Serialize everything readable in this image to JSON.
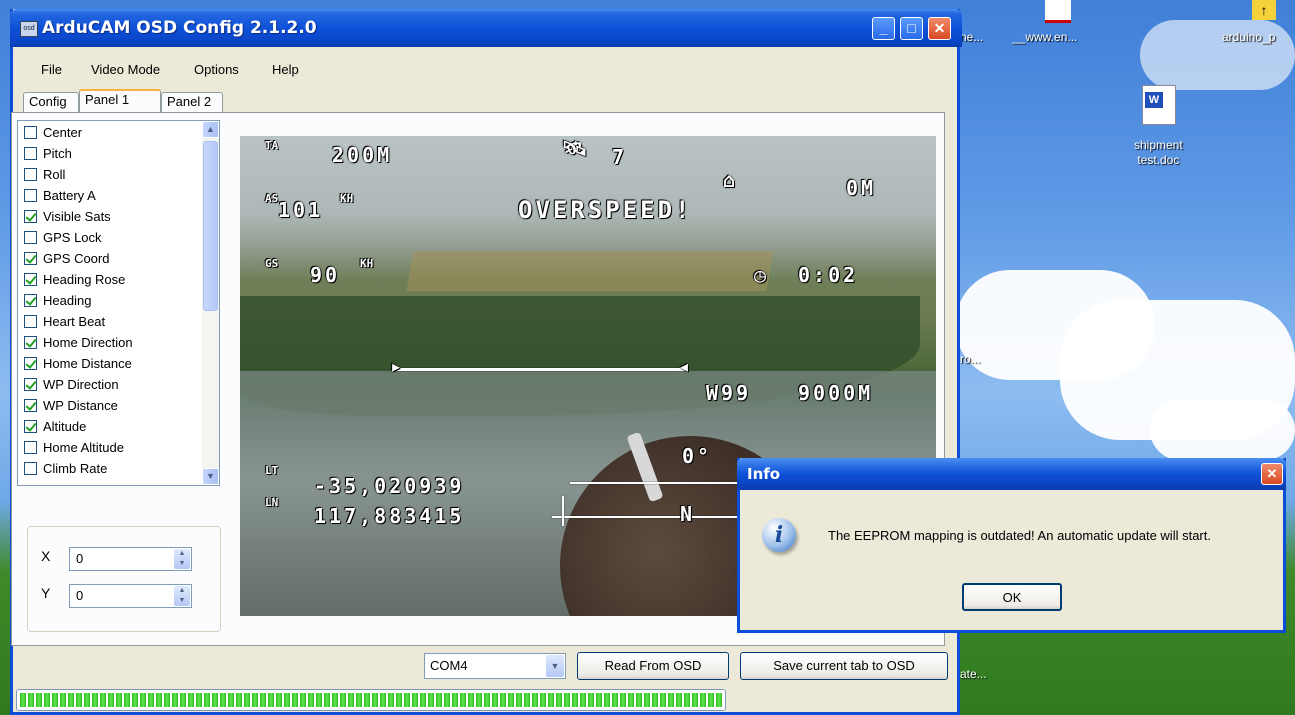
{
  "window": {
    "title": "ArduCAM OSD Config 2.1.2.0",
    "app_icon_label": "osd",
    "minimize": "_",
    "maximize": "□",
    "close": "✕"
  },
  "menu": {
    "file": "File",
    "video_mode": "Video Mode",
    "options": "Options",
    "help": "Help"
  },
  "tabs": {
    "config": "Config",
    "panel1": "Panel 1",
    "panel2": "Panel 2"
  },
  "checklist": [
    {
      "label": "Center",
      "checked": false
    },
    {
      "label": "Pitch",
      "checked": false
    },
    {
      "label": "Roll",
      "checked": false
    },
    {
      "label": "Battery A",
      "checked": false
    },
    {
      "label": "Visible Sats",
      "checked": true
    },
    {
      "label": "GPS Lock",
      "checked": false
    },
    {
      "label": "GPS Coord",
      "checked": true
    },
    {
      "label": "Heading Rose",
      "checked": true
    },
    {
      "label": "Heading",
      "checked": true
    },
    {
      "label": "Heart Beat",
      "checked": false
    },
    {
      "label": "Home Direction",
      "checked": true
    },
    {
      "label": "Home Distance",
      "checked": true
    },
    {
      "label": "WP Direction",
      "checked": true
    },
    {
      "label": "WP Distance",
      "checked": true
    },
    {
      "label": "Altitude",
      "checked": true
    },
    {
      "label": "Home Altitude",
      "checked": false
    },
    {
      "label": "Climb Rate",
      "checked": false
    }
  ],
  "position": {
    "x_label": "X",
    "x_value": "0",
    "y_label": "Y",
    "y_value": "0"
  },
  "osd": {
    "alt_label": "TA",
    "alt_value": "200M",
    "sats": "7",
    "home_dist": "0M",
    "airspeed_label": "AS",
    "airspeed": "101",
    "speed_unit": "KH",
    "overspeed": "OVERSPEED!",
    "groundspeed_label": "GS",
    "groundspeed": "90",
    "timer": "0:02",
    "wp": "W99",
    "wp_dist": "9000M",
    "heading": "0°",
    "lat_label": "LT",
    "lat": "-35,020939",
    "lon_label": "LN",
    "lon": "117,883415",
    "rose_n": "N"
  },
  "bottom": {
    "port": "COM4",
    "read_button": "Read From OSD",
    "save_button": "Save current tab to OSD",
    "progress": 1.0
  },
  "dialog": {
    "title": "Info",
    "message": "The EEPROM mapping is outdated! An automatic update will start.",
    "ok": "OK",
    "icon": "i"
  },
  "desktop": {
    "labels": [
      "ne...",
      "__www.en...",
      "arduino_p",
      "shipment\ntest.doc",
      "ro...",
      "ate..."
    ]
  }
}
